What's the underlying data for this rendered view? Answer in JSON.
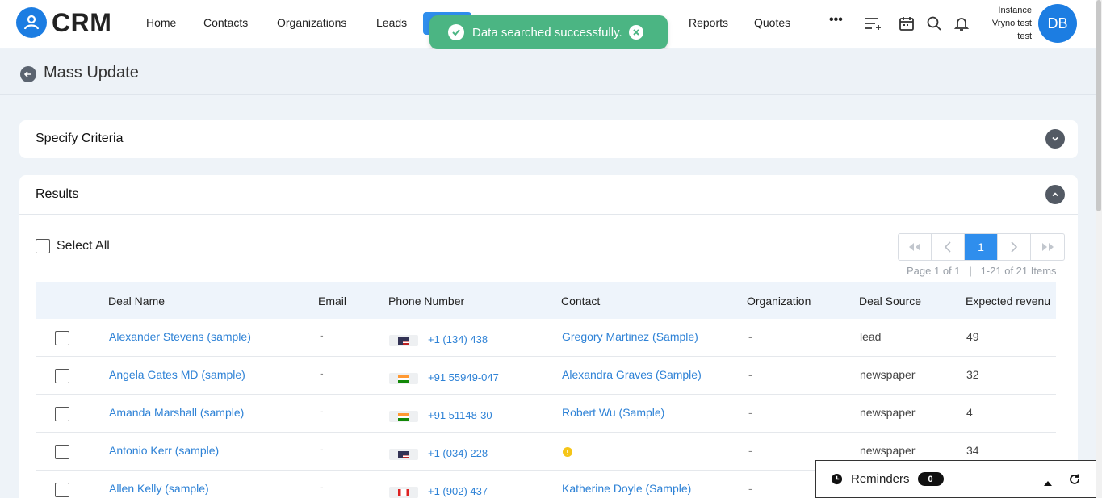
{
  "app": {
    "name": "CRM"
  },
  "nav": {
    "items": [
      "Home",
      "Contacts",
      "Organizations",
      "Leads",
      "Reports",
      "Quotes"
    ],
    "more": "•••"
  },
  "toast": {
    "message": "Data searched successfully.",
    "color": "#4bb583"
  },
  "user": {
    "instance_line1": "Instance",
    "instance_line2": "Vryno test",
    "instance_line3": "test",
    "initials": "DB"
  },
  "page": {
    "title": "Mass Update"
  },
  "criteria": {
    "title": "Specify Criteria"
  },
  "results": {
    "title": "Results",
    "select_all_label": "Select All",
    "pagination": {
      "first": "«",
      "prev": "‹",
      "current": "1",
      "next": "›",
      "last": "»",
      "page_info": "Page 1 of 1",
      "items_info": "1-21 of 21 Items"
    },
    "columns": [
      "Deal Name",
      "Email",
      "Phone Number",
      "Contact",
      "Organization",
      "Deal Source",
      "Expected revenu"
    ],
    "rows": [
      {
        "deal": "Alexander Stevens (sample)",
        "email": "-",
        "flag": "us",
        "phone": "+1 (134) 438",
        "contact": "Gregory Martinez (Sample)",
        "org": "-",
        "source": "lead",
        "revenue": "49"
      },
      {
        "deal": "Angela Gates MD (sample)",
        "email": "-",
        "flag": "in",
        "phone": "+91 55949-047",
        "contact": "Alexandra Graves (Sample)",
        "org": "-",
        "source": "newspaper",
        "revenue": "32"
      },
      {
        "deal": "Amanda Marshall (sample)",
        "email": "-",
        "flag": "in",
        "phone": "+91 51148-30",
        "contact": "Robert Wu (Sample)",
        "org": "-",
        "source": "newspaper",
        "revenue": "4"
      },
      {
        "deal": "Antonio Kerr (sample)",
        "email": "-",
        "flag": "us",
        "phone": "+1 (034) 228",
        "contact": "",
        "org": "-",
        "source": "newspaper",
        "revenue": "34"
      },
      {
        "deal": "Allen Kelly (sample)",
        "email": "-",
        "flag": "ca",
        "phone": "+1 (902) 437",
        "contact": "Katherine Doyle (Sample)",
        "org": "-",
        "source": "",
        "revenue": ""
      }
    ]
  },
  "reminders": {
    "label": "Reminders",
    "count": "0"
  },
  "colors": {
    "primary": "#2f8eed",
    "brand": "#1c7de2",
    "link": "#2e82d6"
  }
}
